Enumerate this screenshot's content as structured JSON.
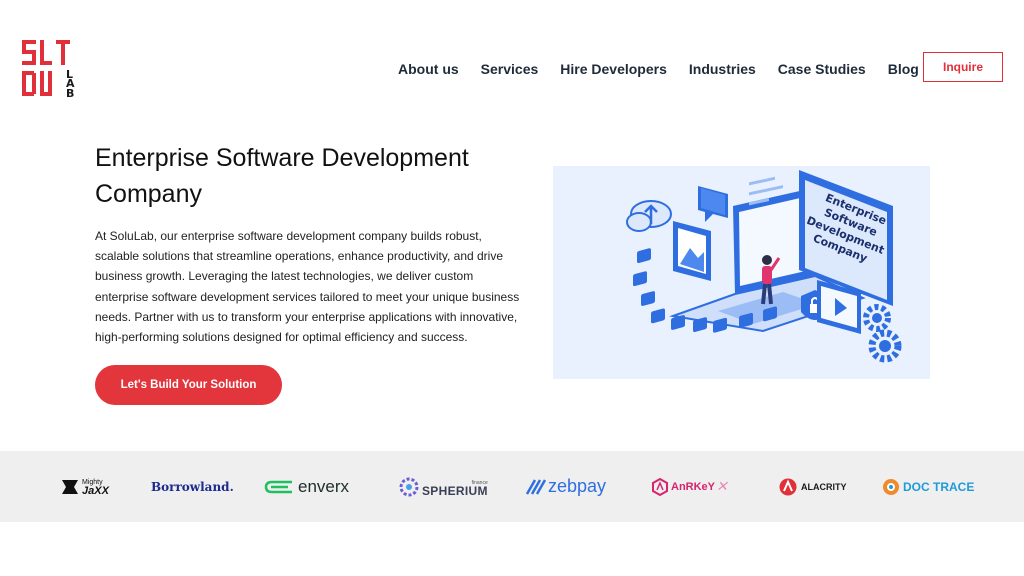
{
  "header": {
    "nav": [
      "About us",
      "Services",
      "Hire Developers",
      "Industries",
      "Case Studies",
      "Blog"
    ],
    "inquire_label": "Inquire"
  },
  "hero": {
    "title": "Enterprise Software Development Company",
    "description": "At SoluLab, our enterprise software development company builds robust, scalable solutions that streamline operations, enhance productivity, and drive business growth. Leveraging the latest technologies, we deliver custom enterprise software development services tailored to meet your unique business needs. Partner with us to transform your enterprise applications with innovative, high-performing solutions designed for optimal efficiency and success.",
    "cta_label": "Let's Build Your Solution",
    "illustration_text": [
      "Enterprise",
      "Software",
      "Development",
      "Company"
    ]
  },
  "clients": [
    {
      "name": "JaXX",
      "tag": "Mighty",
      "icon": "mightyjaxx-logo-icon",
      "color": "#111111"
    },
    {
      "name": "Borrowland.",
      "icon": "borrowland-logo-icon",
      "color": "#1b2a8c"
    },
    {
      "name": "enverx",
      "icon": "enverx-logo-icon",
      "color": "#1f2d2a"
    },
    {
      "name": "SPHERIUM",
      "tag": "finance",
      "icon": "spherium-logo-icon",
      "color": "#3a3f55"
    },
    {
      "name": "zebpay",
      "icon": "zebpay-logo-icon",
      "color": "#2f6fe0"
    },
    {
      "name": "AnRKeY",
      "icon": "anrkey-logo-icon",
      "color": "#d6246e"
    },
    {
      "name": "ALACRITY",
      "icon": "alacrity-logo-icon",
      "color": "#1a1a1a"
    },
    {
      "name": "DOC TRACE",
      "icon": "doctrace-logo-icon",
      "color": "#1f9bd6"
    }
  ],
  "colors": {
    "accent": "#e2353c",
    "illustration_bg": "#e8f1fd",
    "illustration_blue": "#2f6ee0"
  }
}
